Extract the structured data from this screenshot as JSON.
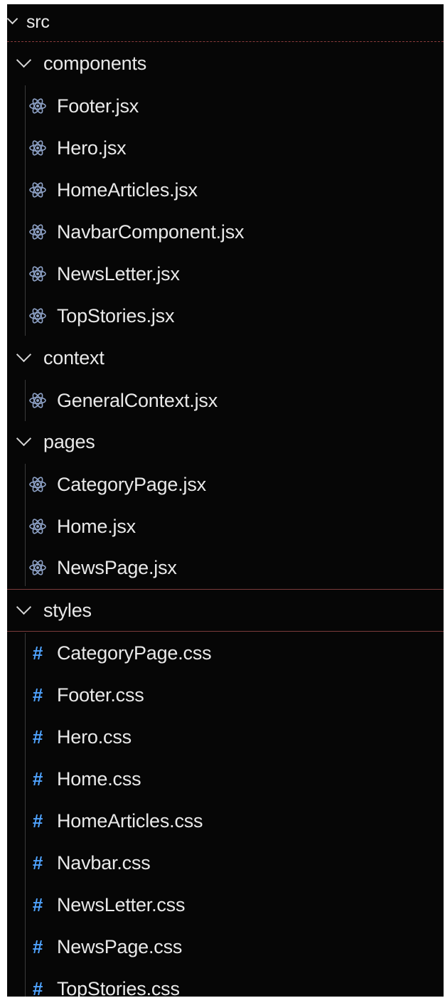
{
  "tree": {
    "root": {
      "label": "src"
    },
    "folders": [
      {
        "label": "components",
        "files": [
          {
            "label": "Footer.jsx",
            "icon": "react-icon"
          },
          {
            "label": "Hero.jsx",
            "icon": "react-icon"
          },
          {
            "label": "HomeArticles.jsx",
            "icon": "react-icon"
          },
          {
            "label": "NavbarComponent.jsx",
            "icon": "react-icon"
          },
          {
            "label": "NewsLetter.jsx",
            "icon": "react-icon"
          },
          {
            "label": "TopStories.jsx",
            "icon": "react-icon"
          }
        ]
      },
      {
        "label": "context",
        "files": [
          {
            "label": "GeneralContext.jsx",
            "icon": "react-icon"
          }
        ]
      },
      {
        "label": "pages",
        "files": [
          {
            "label": "CategoryPage.jsx",
            "icon": "react-icon"
          },
          {
            "label": "Home.jsx",
            "icon": "react-icon"
          },
          {
            "label": "NewsPage.jsx",
            "icon": "react-icon"
          }
        ]
      },
      {
        "label": "styles",
        "files": [
          {
            "label": "CategoryPage.css",
            "icon": "css-hash-icon",
            "glyph": "#"
          },
          {
            "label": "Footer.css",
            "icon": "css-hash-icon",
            "glyph": "#"
          },
          {
            "label": "Hero.css",
            "icon": "css-hash-icon",
            "glyph": "#"
          },
          {
            "label": "Home.css",
            "icon": "css-hash-icon",
            "glyph": "#"
          },
          {
            "label": "HomeArticles.css",
            "icon": "css-hash-icon",
            "glyph": "#"
          },
          {
            "label": "Navbar.css",
            "icon": "css-hash-icon",
            "glyph": "#"
          },
          {
            "label": "NewsLetter.css",
            "icon": "css-hash-icon",
            "glyph": "#"
          },
          {
            "label": "NewsPage.css",
            "icon": "css-hash-icon",
            "glyph": "#"
          },
          {
            "label": "TopStories.css",
            "icon": "css-hash-icon",
            "glyph": "#"
          }
        ]
      }
    ]
  },
  "colors": {
    "background": "#060606",
    "text": "#e9e9e9",
    "react_icon": "#8fa3c8",
    "css_hash": "#4fa3ff",
    "accent_divider": "#7c3b3b"
  }
}
